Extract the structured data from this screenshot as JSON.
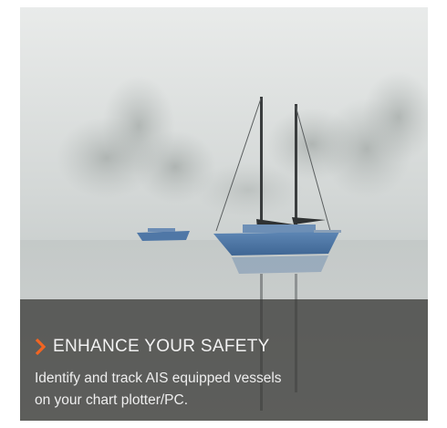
{
  "promo": {
    "image": {
      "alt": "",
      "icon": "sailboat-in-fog-photo"
    },
    "headline": "ENHANCE YOUR SAFETY",
    "headline_icon": "chevron-right-icon",
    "body_lines": [
      "Identify and track AIS equipped vessels",
      "on your chart plotter/PC."
    ]
  },
  "colors": {
    "accent": "#f26522",
    "caption_bg": "#343432",
    "text": "#f2f2f2"
  }
}
